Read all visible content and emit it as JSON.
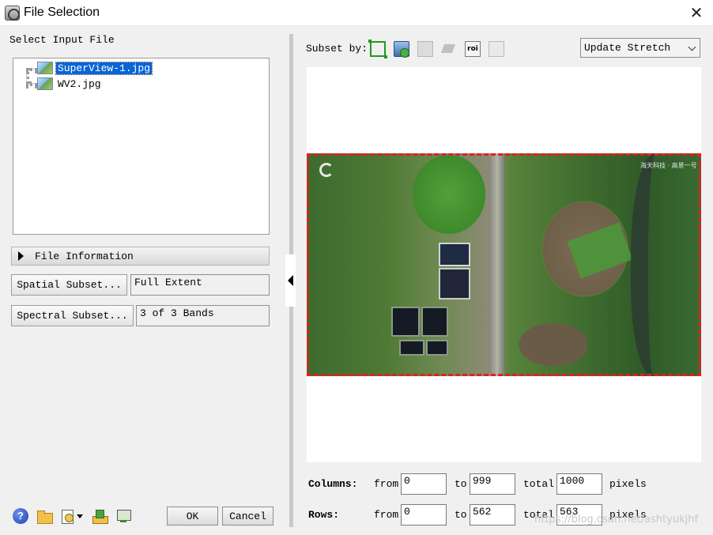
{
  "window": {
    "title": "File Selection",
    "close_glyph": "✕"
  },
  "left_panel": {
    "select_input_label": "Select Input File",
    "files": [
      {
        "name": "SuperView-1.jpg",
        "selected": true,
        "icon": "image-file-icon"
      },
      {
        "name": "WV2.jpg",
        "selected": false,
        "icon": "image-file-icon"
      }
    ],
    "file_information_label": "File Information",
    "spatial_subset": {
      "button_label": "Spatial Subset...",
      "value": "Full Extent"
    },
    "spectral_subset": {
      "button_label": "Spectral Subset...",
      "value": "3 of 3 Bands"
    },
    "toolbar_icons": [
      "help-icon",
      "open-folder-icon",
      "recent-files-icon",
      "export-icon",
      "monitor-icon"
    ],
    "help_glyph": "?",
    "ok_label": "OK",
    "cancel_label": "Cancel"
  },
  "right_panel": {
    "subset_by_label": "Subset by:",
    "subset_icons": [
      "bbox-icon",
      "image-subset-icon",
      "map-subset-icon",
      "vector-subset-icon",
      "roi-subset-icon",
      "file-subset-icon"
    ],
    "roi_icon_text": "roi",
    "stretch": {
      "selected": "Update Stretch"
    },
    "preview_watermark": "海天科技 · 高景一号",
    "columns": {
      "label": "Columns:",
      "from_label": "from",
      "from": "0",
      "to_label": "to",
      "to": "999",
      "total_label": "total",
      "total": "1000",
      "unit": "pixels"
    },
    "rows": {
      "label": "Rows:",
      "from_label": "from",
      "from": "0",
      "to_label": "to",
      "to": "562",
      "total_label": "total",
      "total": "563",
      "unit": "pixels"
    }
  },
  "page_watermark": "https://blog.csdn.net/ashtyukjhf",
  "colors": {
    "selection": "#0a64d6",
    "subset_box": "#e02020",
    "dialog_bg": "#f0f0f0"
  }
}
